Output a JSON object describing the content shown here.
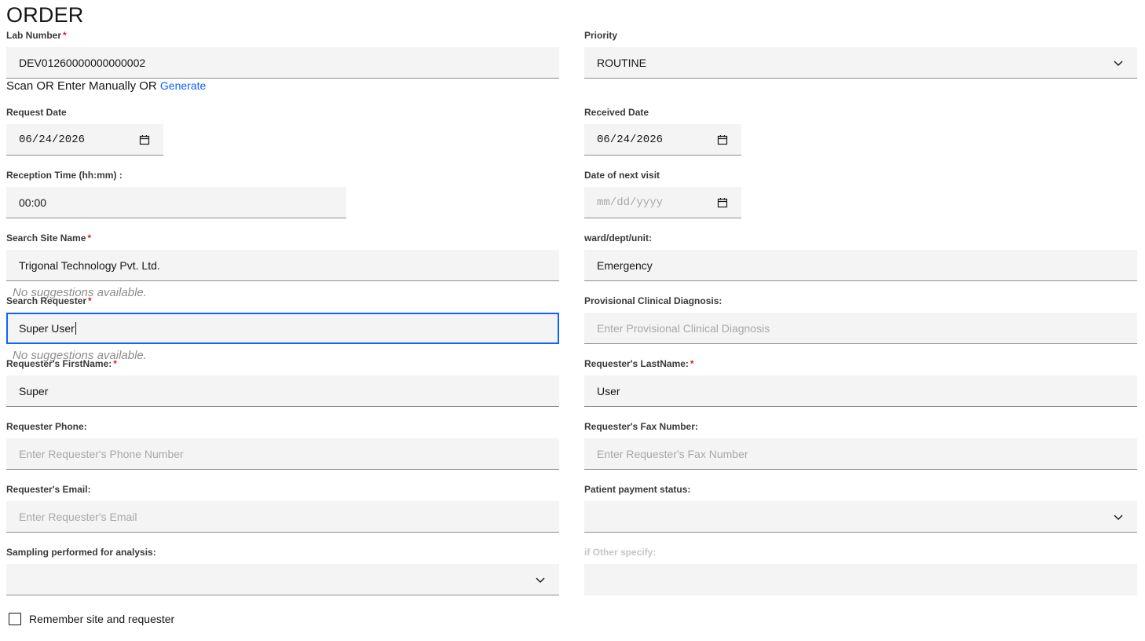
{
  "page": {
    "title": "ORDER"
  },
  "lab_number": {
    "label": "Lab Number",
    "required_mark": "*",
    "value": "DEV01260000000000002",
    "helper_text": "Scan OR Enter Manually OR",
    "generate_link": "Generate"
  },
  "priority": {
    "label": "Priority",
    "value": "ROUTINE"
  },
  "request_date": {
    "label": "Request Date",
    "value": "06/24/2026"
  },
  "received_date": {
    "label": "Received Date",
    "value": "06/24/2026"
  },
  "reception_time": {
    "label": "Reception Time (hh:mm) :",
    "value": "00:00"
  },
  "next_visit_date": {
    "label": "Date of next visit",
    "placeholder": "mm/dd/yyyy"
  },
  "site_name": {
    "label": "Search Site Name",
    "required_mark": "*",
    "value": "Trigonal Technology Pvt. Ltd.",
    "no_suggestions": "No suggestions available."
  },
  "ward": {
    "label": "ward/dept/unit:",
    "value": "Emergency"
  },
  "requester": {
    "label": "Search Requester",
    "required_mark": "*",
    "value": "Super User",
    "no_suggestions": "No suggestions available."
  },
  "clinical_diagnosis": {
    "label": "Provisional Clinical Diagnosis:",
    "placeholder": "Enter Provisional Clinical Diagnosis"
  },
  "requester_first_name": {
    "label": "Requester's FirstName:",
    "required_mark": "*",
    "value": "Super"
  },
  "requester_last_name": {
    "label": "Requester's LastName:",
    "required_mark": "*",
    "value": "User"
  },
  "requester_phone": {
    "label": "Requester Phone:",
    "placeholder": "Enter Requester's Phone Number"
  },
  "requester_fax": {
    "label": "Requester's Fax Number:",
    "placeholder": "Enter Requester's Fax Number"
  },
  "requester_email": {
    "label": "Requester's Email:",
    "placeholder": "Enter Requester's Email"
  },
  "payment_status": {
    "label": "Patient payment status:",
    "value": ""
  },
  "sampling": {
    "label": "Sampling performed for analysis:",
    "value": ""
  },
  "other_specify": {
    "label": "if Other specify:",
    "value": ""
  },
  "remember": {
    "label": "Remember site and requester",
    "checked": false
  },
  "icons": {
    "calendar": "calendar-icon",
    "chevron": "chevron-down-icon"
  },
  "colors": {
    "accent": "#0f62fe",
    "required": "#da1e28",
    "field_bg": "#f4f4f4"
  }
}
